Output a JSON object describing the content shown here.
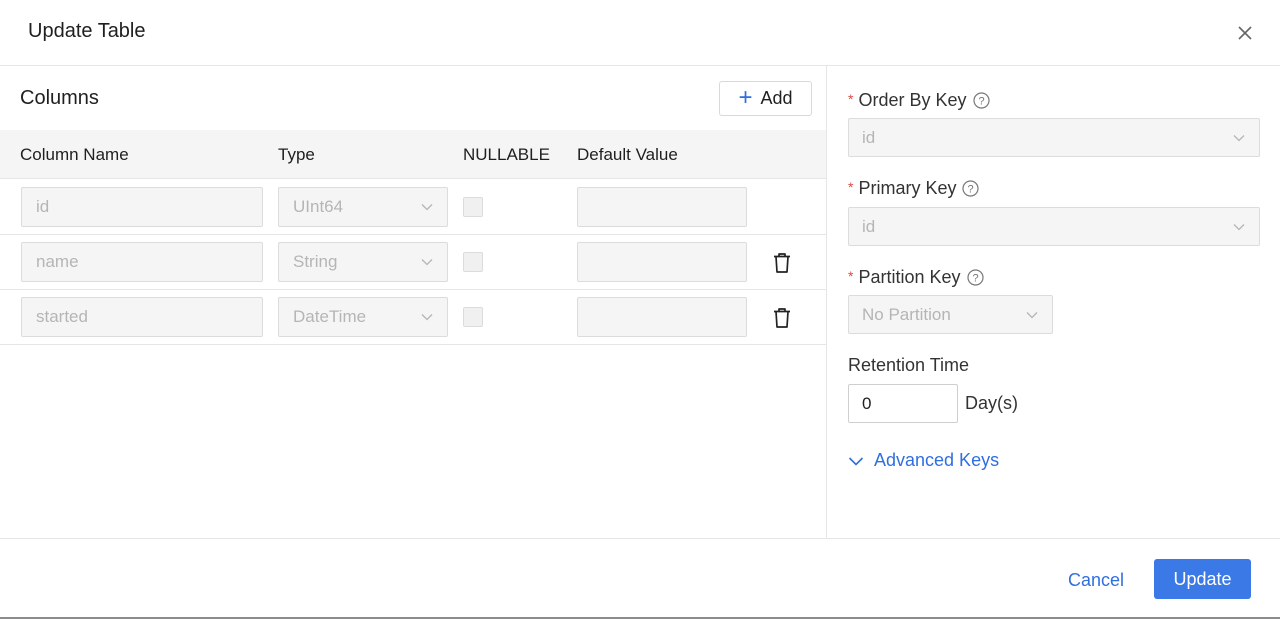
{
  "dialog": {
    "title": "Update Table"
  },
  "columns_panel": {
    "title": "Columns",
    "add_label": "Add",
    "headers": [
      "Column Name",
      "Type",
      "NULLABLE",
      "Default Value"
    ],
    "rows": [
      {
        "name": "id",
        "type": "UInt64",
        "nullable": false,
        "default": "",
        "deletable": false
      },
      {
        "name": "name",
        "type": "String",
        "nullable": false,
        "default": "",
        "deletable": true
      },
      {
        "name": "started",
        "type": "DateTime",
        "nullable": false,
        "default": "",
        "deletable": true
      }
    ]
  },
  "keys_panel": {
    "order_by_key": {
      "label": "Order By Key",
      "value": "id",
      "required": true
    },
    "primary_key": {
      "label": "Primary Key",
      "value": "id",
      "required": true
    },
    "partition_key": {
      "label": "Partition Key",
      "value": "No Partition",
      "required": true
    },
    "retention": {
      "label": "Retention Time",
      "value": "0",
      "unit": "Day(s)"
    },
    "advanced_label": "Advanced Keys"
  },
  "footer": {
    "cancel_label": "Cancel",
    "update_label": "Update"
  },
  "colors": {
    "accent": "#3b7ae6",
    "link": "#2f6fe0",
    "required": "#e0463c"
  }
}
